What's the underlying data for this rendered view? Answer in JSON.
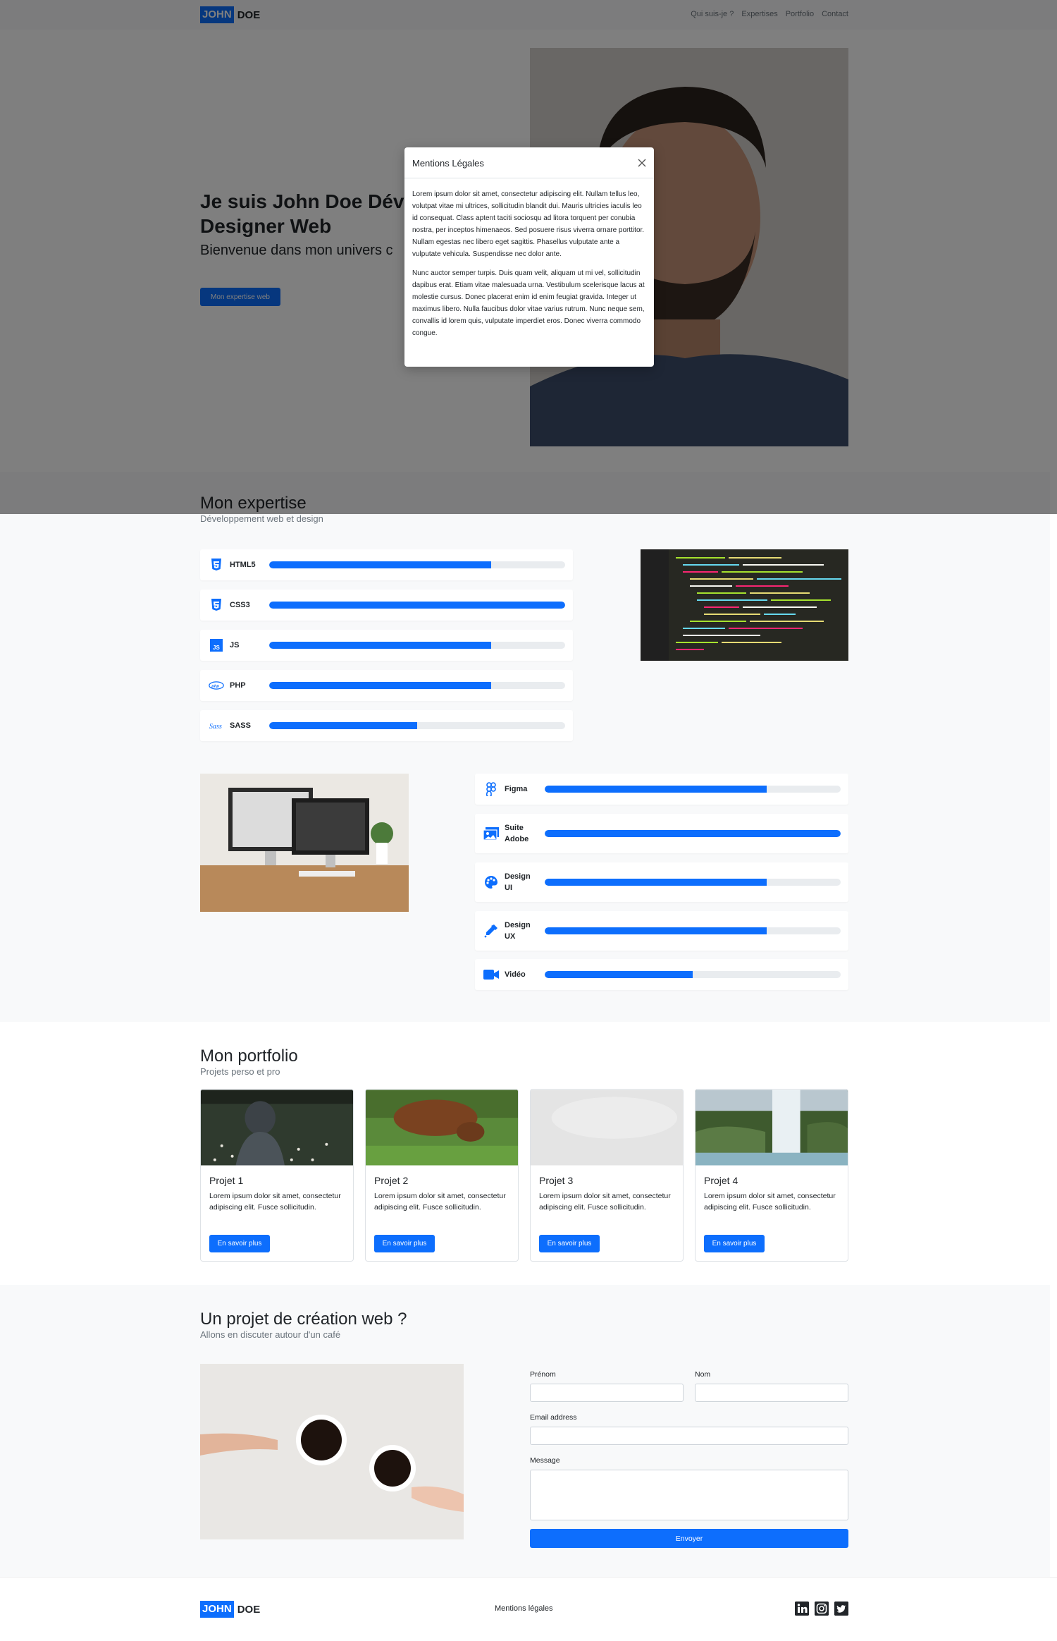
{
  "nav": {
    "brand_a": "JOHN",
    "brand_b": "DOE",
    "links": [
      "Qui suis-je ?",
      "Expertises",
      "Portfolio",
      "Contact"
    ]
  },
  "hero": {
    "title_line1": "Je suis John Doe Déve",
    "title_line2": "Designer Web",
    "subtitle": "Bienvenue dans mon univers c",
    "button": "Mon expertise web"
  },
  "expertise": {
    "title": "Mon expertise",
    "subtitle": "Développement web et design",
    "dev_skills": [
      {
        "name": "HTML5",
        "icon": "html5-icon",
        "level": 0.75
      },
      {
        "name": "CSS3",
        "icon": "css3-icon",
        "level": 1.0
      },
      {
        "name": "JS",
        "icon": "js-icon",
        "level": 0.75
      },
      {
        "name": "PHP",
        "icon": "php-icon",
        "level": 0.75
      },
      {
        "name": "SASS",
        "icon": "sass-icon",
        "level": 0.5
      }
    ],
    "design_skills": [
      {
        "name": "Figma",
        "icon": "figma-icon",
        "level": 0.75
      },
      {
        "name": "Suite Adobe",
        "icon": "images-icon",
        "level": 1.0
      },
      {
        "name": "Design UI",
        "icon": "palette-icon",
        "level": 0.75
      },
      {
        "name": "Design UX",
        "icon": "eyedropper-icon",
        "level": 0.75
      },
      {
        "name": "Vidéo",
        "icon": "camera-video-icon",
        "level": 0.5
      }
    ]
  },
  "portfolio": {
    "title": "Mon portfolio",
    "subtitle": "Projets perso et pro",
    "projects": [
      {
        "title": "Projet 1",
        "text": "Lorem ipsum dolor sit amet, consectetur adipiscing elit. Fusce sollicitudin.",
        "button": "En savoir plus"
      },
      {
        "title": "Projet 2",
        "text": "Lorem ipsum dolor sit amet, consectetur adipiscing elit. Fusce sollicitudin.",
        "button": "En savoir plus"
      },
      {
        "title": "Projet 3",
        "text": "Lorem ipsum dolor sit amet, consectetur adipiscing elit. Fusce sollicitudin.",
        "button": "En savoir plus"
      },
      {
        "title": "Projet 4",
        "text": "Lorem ipsum dolor sit amet, consectetur adipiscing elit. Fusce sollicitudin.",
        "button": "En savoir plus"
      }
    ]
  },
  "contact": {
    "title": "Un projet de création web ?",
    "subtitle": "Allons en discuter autour d'un café",
    "firstname_label": "Prénom",
    "lastname_label": "Nom",
    "email_label": "Email address",
    "message_label": "Message",
    "submit": "Envoyer"
  },
  "footer": {
    "brand_a": "JOHN",
    "brand_b": "DOE",
    "legal_link": "Mentions légales",
    "social": [
      "linkedin-icon",
      "instagram-icon",
      "twitter-icon"
    ]
  },
  "modal": {
    "title": "Mentions Légales",
    "paragraph1": "Lorem ipsum dolor sit amet, consectetur adipiscing elit. Nullam tellus leo, volutpat vitae mi ultrices, sollicitudin blandit dui. Mauris ultricies iaculis leo id consequat. Class aptent taciti sociosqu ad litora torquent per conubia nostra, per inceptos himenaeos. Sed posuere risus viverra ornare porttitor. Nullam egestas nec libero eget sagittis. Phasellus vulputate ante a vulputate vehicula. Suspendisse nec dolor ante.",
    "paragraph2": "Nunc auctor semper turpis. Duis quam velit, aliquam ut mi vel, sollicitudin dapibus erat. Etiam vitae malesuada urna. Vestibulum scelerisque lacus at molestie cursus. Donec placerat enim id enim feugiat gravida. Integer ut maximus libero. Nulla faucibus dolor vitae varius rutrum. Nunc neque sem, convallis id lorem quis, vulputate imperdiet eros. Donec viverra commodo congue."
  },
  "colors": {
    "primary": "#0d6efd",
    "section_bg": "#f8f9fa",
    "backdrop": "rgba(0,0,0,0.5)"
  }
}
